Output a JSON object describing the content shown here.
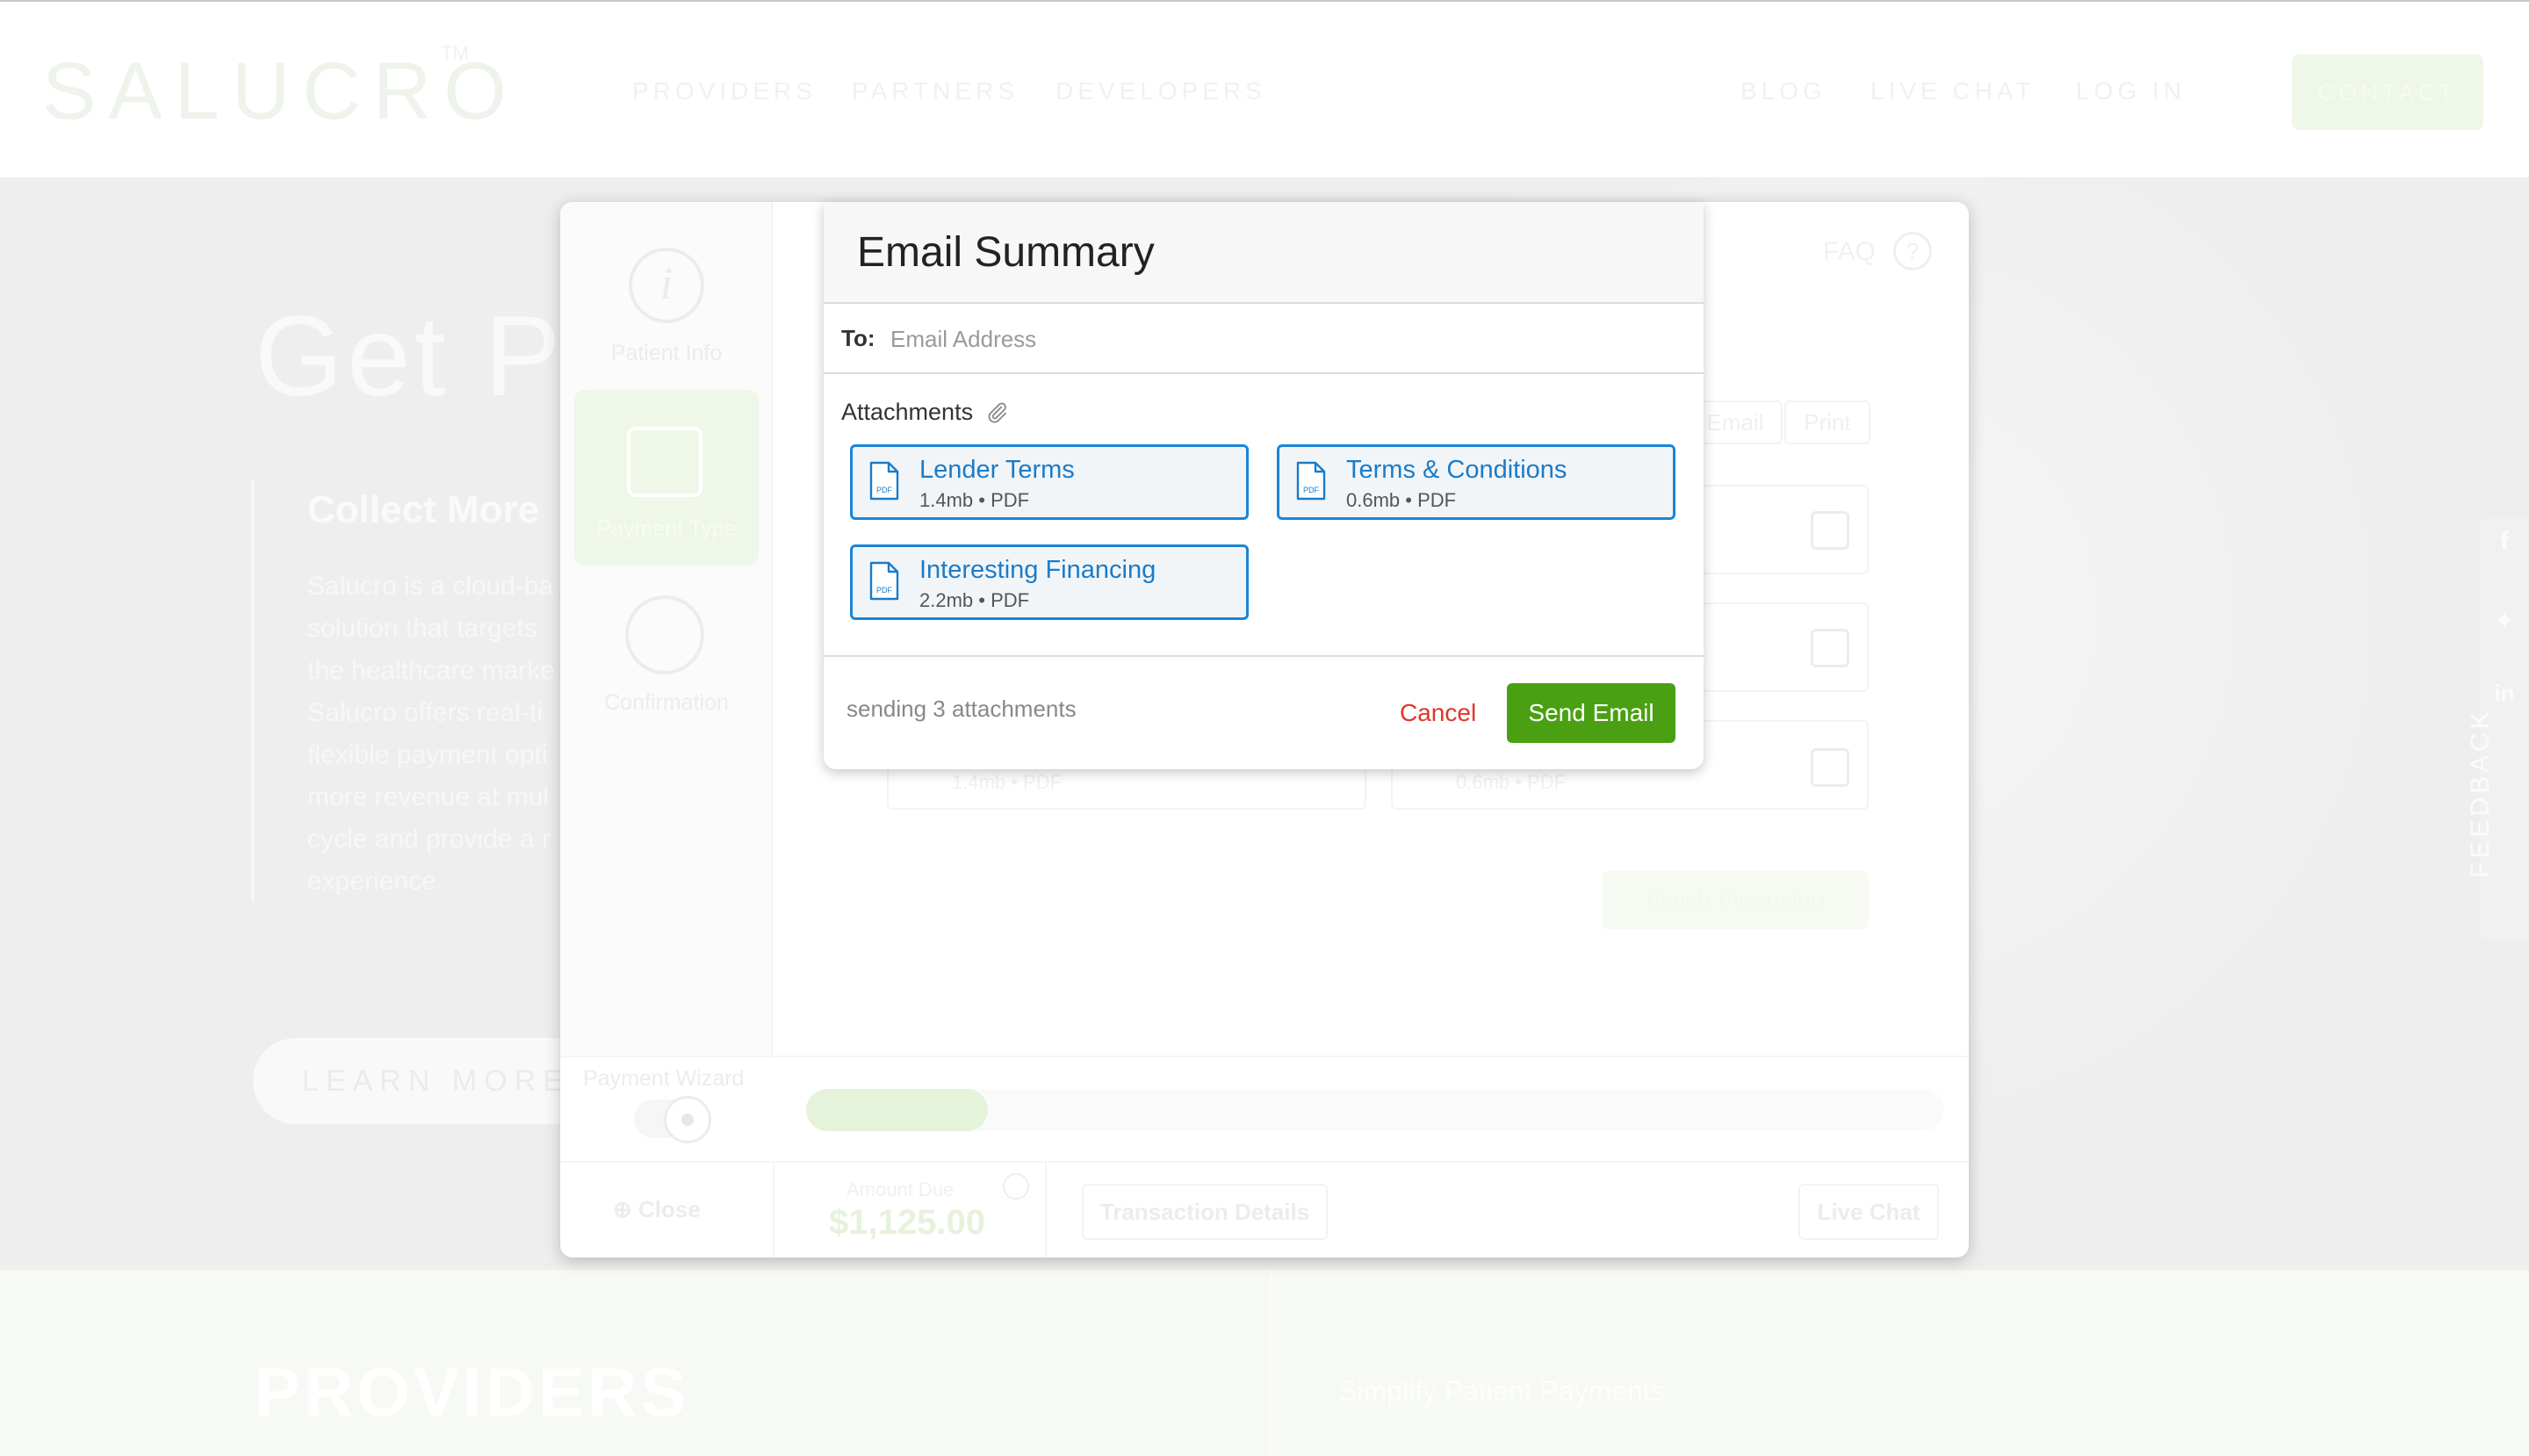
{
  "site": {
    "logo": "SALUCRO",
    "logo_tm": "TM",
    "nav_left": [
      "PROVIDERS",
      "PARTNERS",
      "DEVELOPERS"
    ],
    "nav_right": [
      "BLOG",
      "LIVE CHAT",
      "LOG IN"
    ],
    "contact": "CONTACT"
  },
  "hero": {
    "title": "Get Pa",
    "subtitle": "Collect More",
    "text": "Salucro is a cloud-ba\nsolution that targets\nthe healthcare marke\nSalucro offers real-ti\nflexible payment opti\nmore revenue at mul\ncycle and provide a r\nexperience.",
    "learn_more": "LEARN MORE",
    "feedback": "FEEDBACK"
  },
  "providers": {
    "title": "PROVIDERS",
    "subtitle": "Simplify Patient Payments"
  },
  "wizard": {
    "steps": [
      {
        "label": "Patient Info",
        "icon": "info-icon"
      },
      {
        "label": "Payment Type",
        "icon": "wallet-icon"
      },
      {
        "label": "Confirmation",
        "icon": "check-icon"
      }
    ],
    "faq": "FAQ",
    "faq_icon": "?",
    "email_btn": "Email",
    "print_btn": "Print",
    "ghost_cards": [
      {
        "meta": "1.4mb  •  PDF"
      },
      {
        "meta": "0.6mb  •  PDF"
      }
    ],
    "finish": "Finish Financing",
    "progress_label": "Payment Wizard",
    "progress_fraction": 0.16,
    "close": "Close",
    "amount_label": "Amount Due",
    "amount": "$1,125.00",
    "transaction_details": "Transaction Details",
    "live_chat": "Live Chat"
  },
  "email_dialog": {
    "title": "Email Summary",
    "to_label": "To:",
    "to_placeholder": "Email Address",
    "to_value": "",
    "attachments_label": "Attachments",
    "attachments": [
      {
        "name": "Lender Terms",
        "meta": "1.4mb  •  PDF"
      },
      {
        "name": "Terms & Conditions",
        "meta": "0.6mb  •  PDF"
      },
      {
        "name": "Interesting Financing",
        "meta": "2.2mb  •  PDF"
      }
    ],
    "pdf_badge": "PDF",
    "status": "sending 3 attachments",
    "cancel": "Cancel",
    "send": "Send Email",
    "colors": {
      "accent": "#1a85d8",
      "send": "#4aa012",
      "cancel": "#e0352b"
    }
  }
}
